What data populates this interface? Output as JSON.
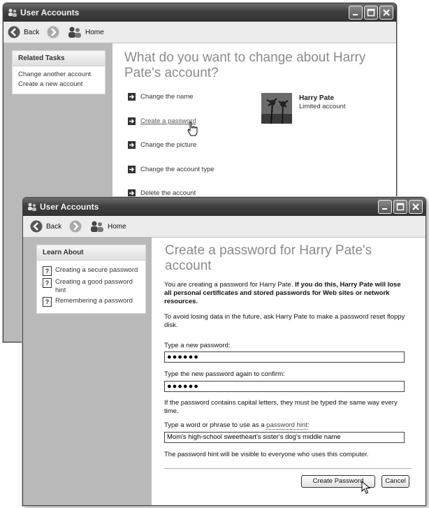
{
  "back_window": {
    "title": "User Accounts",
    "toolbar": {
      "back_label": "Back",
      "home_label": "Home"
    },
    "related_tasks": {
      "header": "Related Tasks",
      "items": [
        "Change another account",
        "Create a new account"
      ]
    },
    "heading": "What do you want to change about Harry Pate's account?",
    "options": [
      "Change the name",
      "Create a password",
      "Change the picture",
      "Change the account type",
      "Delete the account"
    ],
    "user": {
      "name": "Harry Pate",
      "type": "Limited account"
    }
  },
  "front_window": {
    "title": "User Accounts",
    "toolbar": {
      "back_label": "Back",
      "home_label": "Home"
    },
    "learn_about": {
      "header": "Learn About",
      "items": [
        "Creating a secure password",
        "Creating a good password hint",
        "Remembering a password"
      ]
    },
    "heading": "Create a password for Harry Pate's account",
    "intro_plain": "You are creating a password for Harry Pate. ",
    "intro_bold": "If you do this, Harry Pate will lose all personal certificates and stored passwords for Web sites or network resources.",
    "avoid_text": "To avoid losing data in the future, ask Harry Pate to make a password reset floppy disk.",
    "new_password_label": "Type a new password:",
    "new_password_value": "●●●●●●",
    "confirm_label": "Type the new password again to confirm:",
    "confirm_value": "●●●●●●",
    "capital_note": "If the password contains capital letters, they must be typed the same way every time.",
    "hint_label_prefix": "Type a word or phrase to use as a ",
    "hint_link": "password hint",
    "hint_label_suffix": ":",
    "hint_value": "Mom's high-school sweetheart's sister's dog's middle name",
    "hint_visibility_note": "The password hint will be visible to everyone who uses this computer.",
    "create_button": "Create Password",
    "cancel_button": "Cancel"
  }
}
